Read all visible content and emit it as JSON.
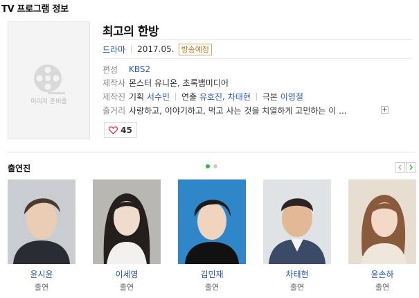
{
  "section_title": "TV 프로그램 정보",
  "poster": {
    "placeholder_text": "이미지 준비중"
  },
  "program": {
    "title": "최고의 한방",
    "genre": "드라마",
    "date": "2017.05.",
    "status_badge": "방송예정",
    "info": {
      "broadcast": {
        "label": "편성",
        "value": "KBS2"
      },
      "production": {
        "label": "제작사",
        "value": "몬스터 유니온, 초록뱀미디어"
      },
      "staff": {
        "label": "제작진",
        "planning_label": "기획",
        "planning": "서수민",
        "directing_label": "연출",
        "directing_1": "유호진",
        "directing_2": "차태현",
        "writing_label": "극본",
        "writing": "이영철"
      },
      "synopsis": {
        "label": "줄거리",
        "value": "사랑하고, 이야기하고, 먹고 사는 것을 치열하게 고민하는 이 ..."
      }
    },
    "more_icon": "plus-icon",
    "likes": "45"
  },
  "cast": {
    "title": "출연진",
    "members": [
      {
        "name": "윤시윤",
        "role": "출연"
      },
      {
        "name": "이세영",
        "role": "출연"
      },
      {
        "name": "김민재",
        "role": "출연"
      },
      {
        "name": "차태현",
        "role": "출연"
      },
      {
        "name": "윤손하",
        "role": "출연"
      }
    ]
  },
  "colors": {
    "link": "#2a55b0",
    "dot_active": "#2fbf3a",
    "dot_inactive": "#cccccc",
    "badge": "#b07c2c",
    "heart": "#e0303a"
  }
}
